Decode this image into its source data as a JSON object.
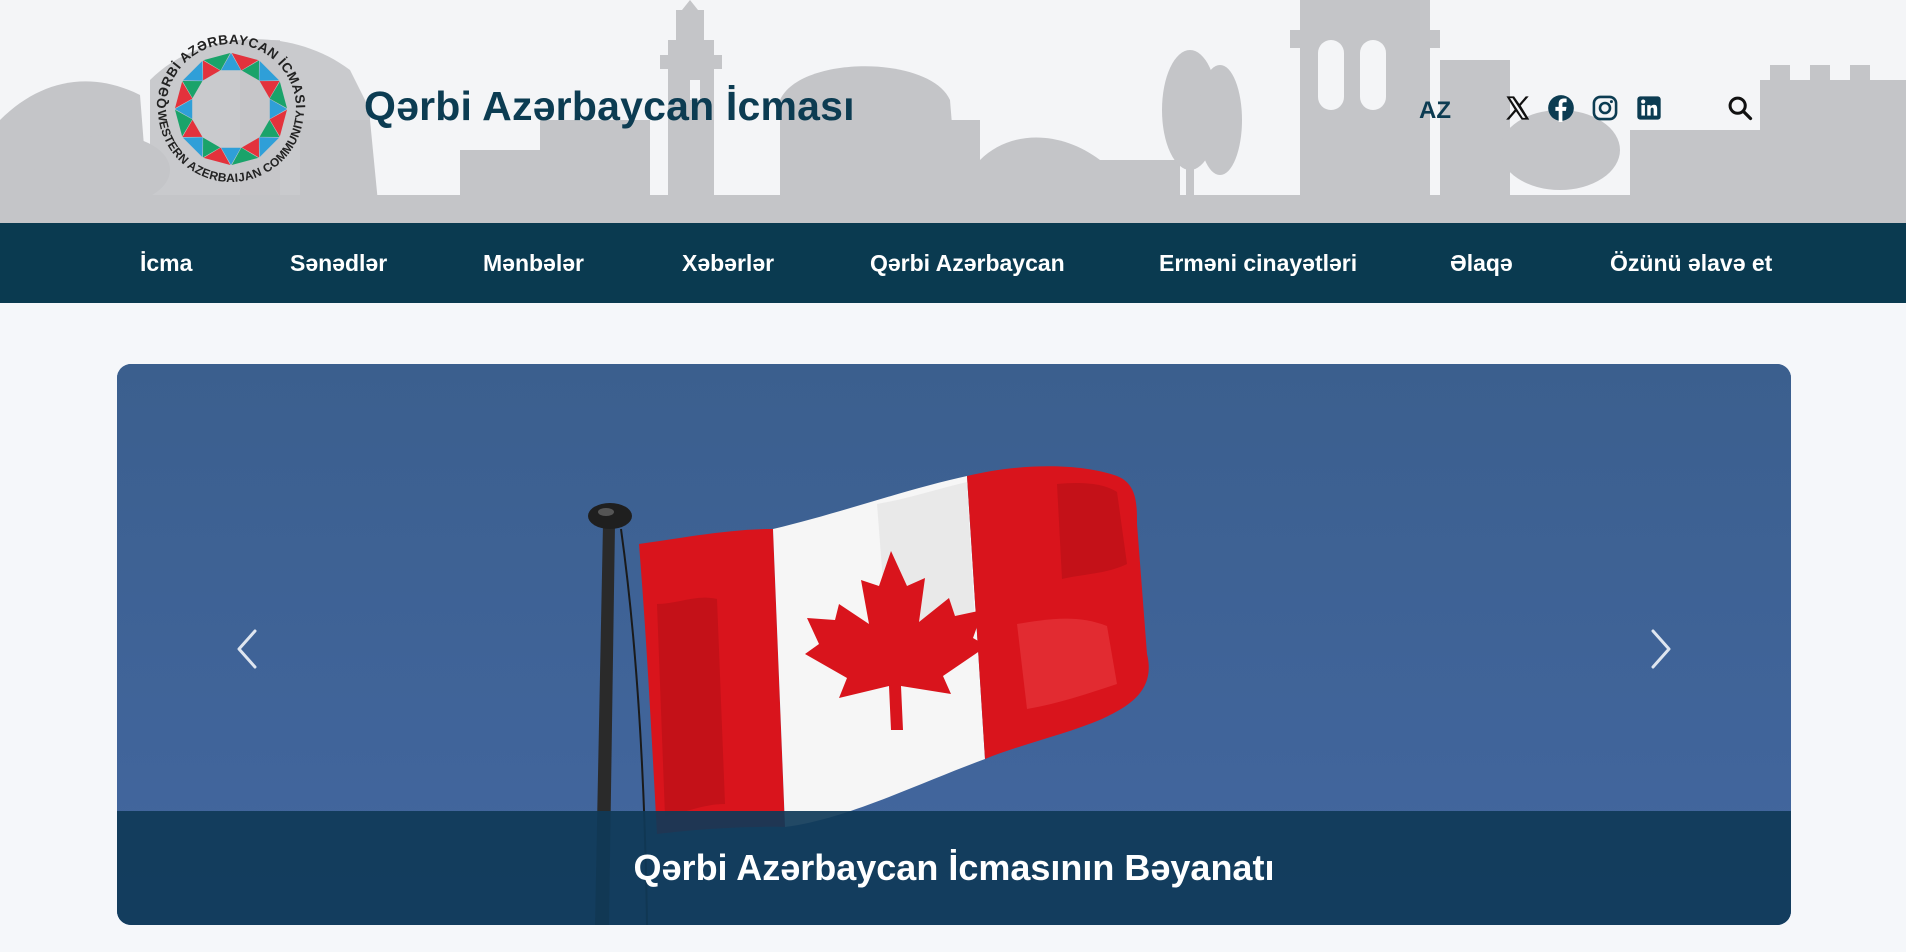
{
  "header": {
    "site_title": "Qərbi Azərbaycan İcması",
    "logo_text_top": "QƏRBİ AZƏRBAYCAN İCMASI",
    "logo_text_bottom": "WESTERN AZERBAIJAN COMMUNITY",
    "language": "AZ",
    "social": [
      "x-icon",
      "facebook-icon",
      "instagram-icon",
      "linkedin-icon"
    ],
    "search_icon": "search-icon"
  },
  "nav": {
    "items": [
      {
        "label": "İcma"
      },
      {
        "label": "Sənədlər"
      },
      {
        "label": "Mənbələr"
      },
      {
        "label": "Xəbərlər"
      },
      {
        "label": "Qərbi Azərbaycan"
      },
      {
        "label": "Erməni cinayətləri"
      },
      {
        "label": "Əlaqə"
      },
      {
        "label": "Özünü əlavə et"
      }
    ]
  },
  "slider": {
    "caption": "Qərbi Azərbaycan İcmasının Bəyanatı",
    "prev_icon": "chevron-left-icon",
    "next_icon": "chevron-right-icon"
  },
  "colors": {
    "brand_dark": "#0a3a50",
    "title": "#0c3c52",
    "sky": "#3e6493",
    "flag_red": "#e0161f"
  }
}
